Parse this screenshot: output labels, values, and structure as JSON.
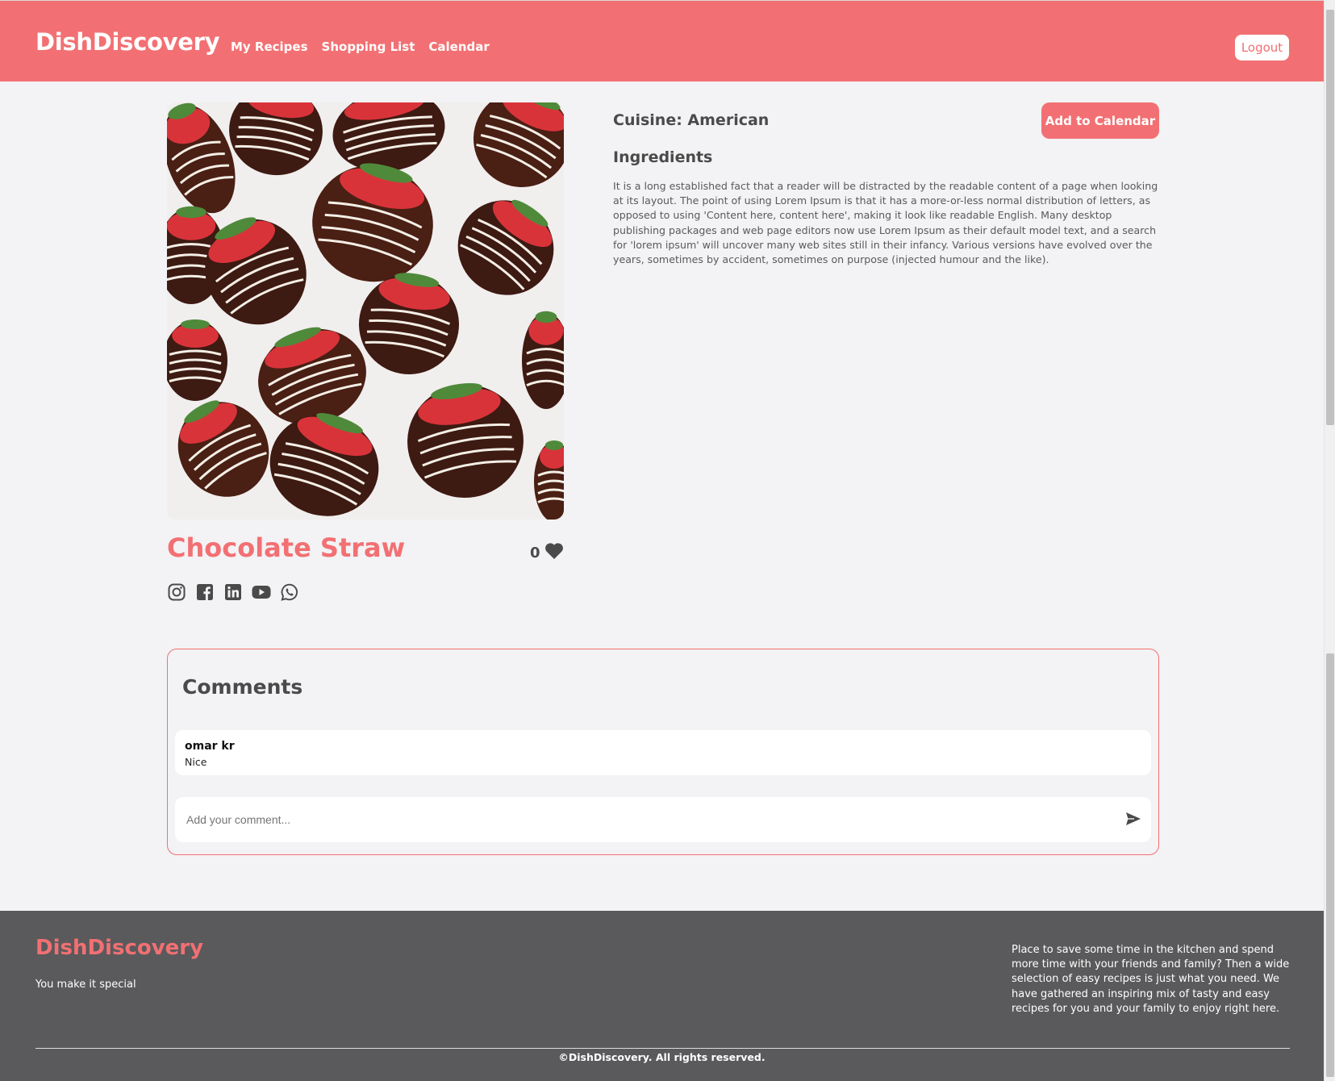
{
  "header": {
    "brand": "DishDiscovery",
    "nav": [
      "My Recipes",
      "Shopping List",
      "Calendar"
    ],
    "logout_label": "Logout"
  },
  "recipe": {
    "title": "Chocolate Straw",
    "likes": "0",
    "cuisine": "Cuisine: American",
    "add_calendar_label": "Add to Calendar",
    "ingredients_title": "Ingredients",
    "ingredients_text": "It is a long established fact that a reader will be distracted by the readable content of a page when looking at its layout. The point of using Lorem Ipsum is that it has a more-or-less normal distribution of letters, as opposed to using 'Content here, content here', making it look like readable English. Many desktop publishing packages and web page editors now use Lorem Ipsum as their default model text, and a search for 'lorem ipsum' will uncover many web sites still in their infancy. Various versions have evolved over the years, sometimes by accident, sometimes on purpose (injected humour and the like).",
    "socials": [
      "instagram-icon",
      "facebook-icon",
      "linkedin-icon",
      "youtube-icon",
      "whatsapp-icon"
    ]
  },
  "comments": {
    "title": "Comments",
    "items": [
      {
        "user": "omar kr",
        "text": "Nice"
      }
    ],
    "input_placeholder": "Add your comment..."
  },
  "footer": {
    "brand": "DishDiscovery",
    "tagline": "You make it special",
    "about": "Place to save some time in the kitchen and spend more time with your friends and family? Then a wide selection of easy recipes is just what you need. We have gathered an inspiring mix of tasty and easy recipes for you and your family to enjoy right here.",
    "copyright": "©DishDiscovery. All rights reserved."
  },
  "colors": {
    "accent": "#f27073",
    "background": "#f3f2f4",
    "footer": "#5a5a5c",
    "text": "#4a4a4a"
  }
}
